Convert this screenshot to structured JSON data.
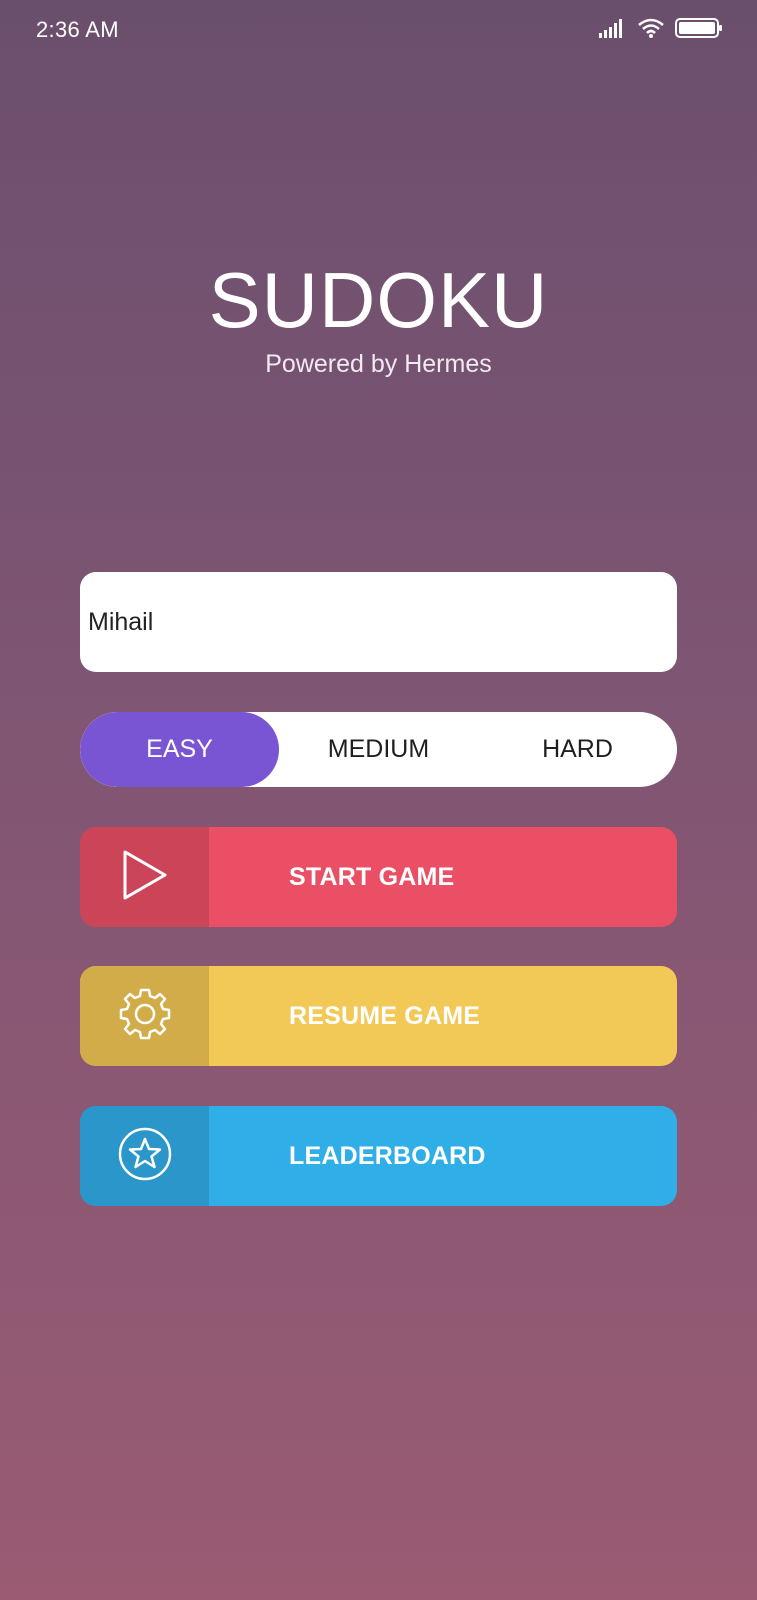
{
  "status_bar": {
    "time": "2:36 AM",
    "icons": [
      "signal-icon",
      "wifi-icon",
      "battery-icon"
    ]
  },
  "header": {
    "title": "SUDOKU",
    "subtitle": "Powered by Hermes"
  },
  "player": {
    "name_value": "Mihail"
  },
  "difficulty": {
    "options": [
      "EASY",
      "MEDIUM",
      "HARD"
    ],
    "selected": "EASY"
  },
  "actions": {
    "start": {
      "label": "START GAME",
      "icon": "play-icon",
      "color": "#ea4f66"
    },
    "resume": {
      "label": "RESUME GAME",
      "icon": "gear-icon",
      "color": "#f2c957"
    },
    "leaderboard": {
      "label": "LEADERBOARD",
      "icon": "star-icon",
      "color": "#30aee8"
    }
  },
  "colors": {
    "accent": "#7a55d3",
    "background_top": "#6a4f6d",
    "background_bottom": "#9a5b73"
  }
}
